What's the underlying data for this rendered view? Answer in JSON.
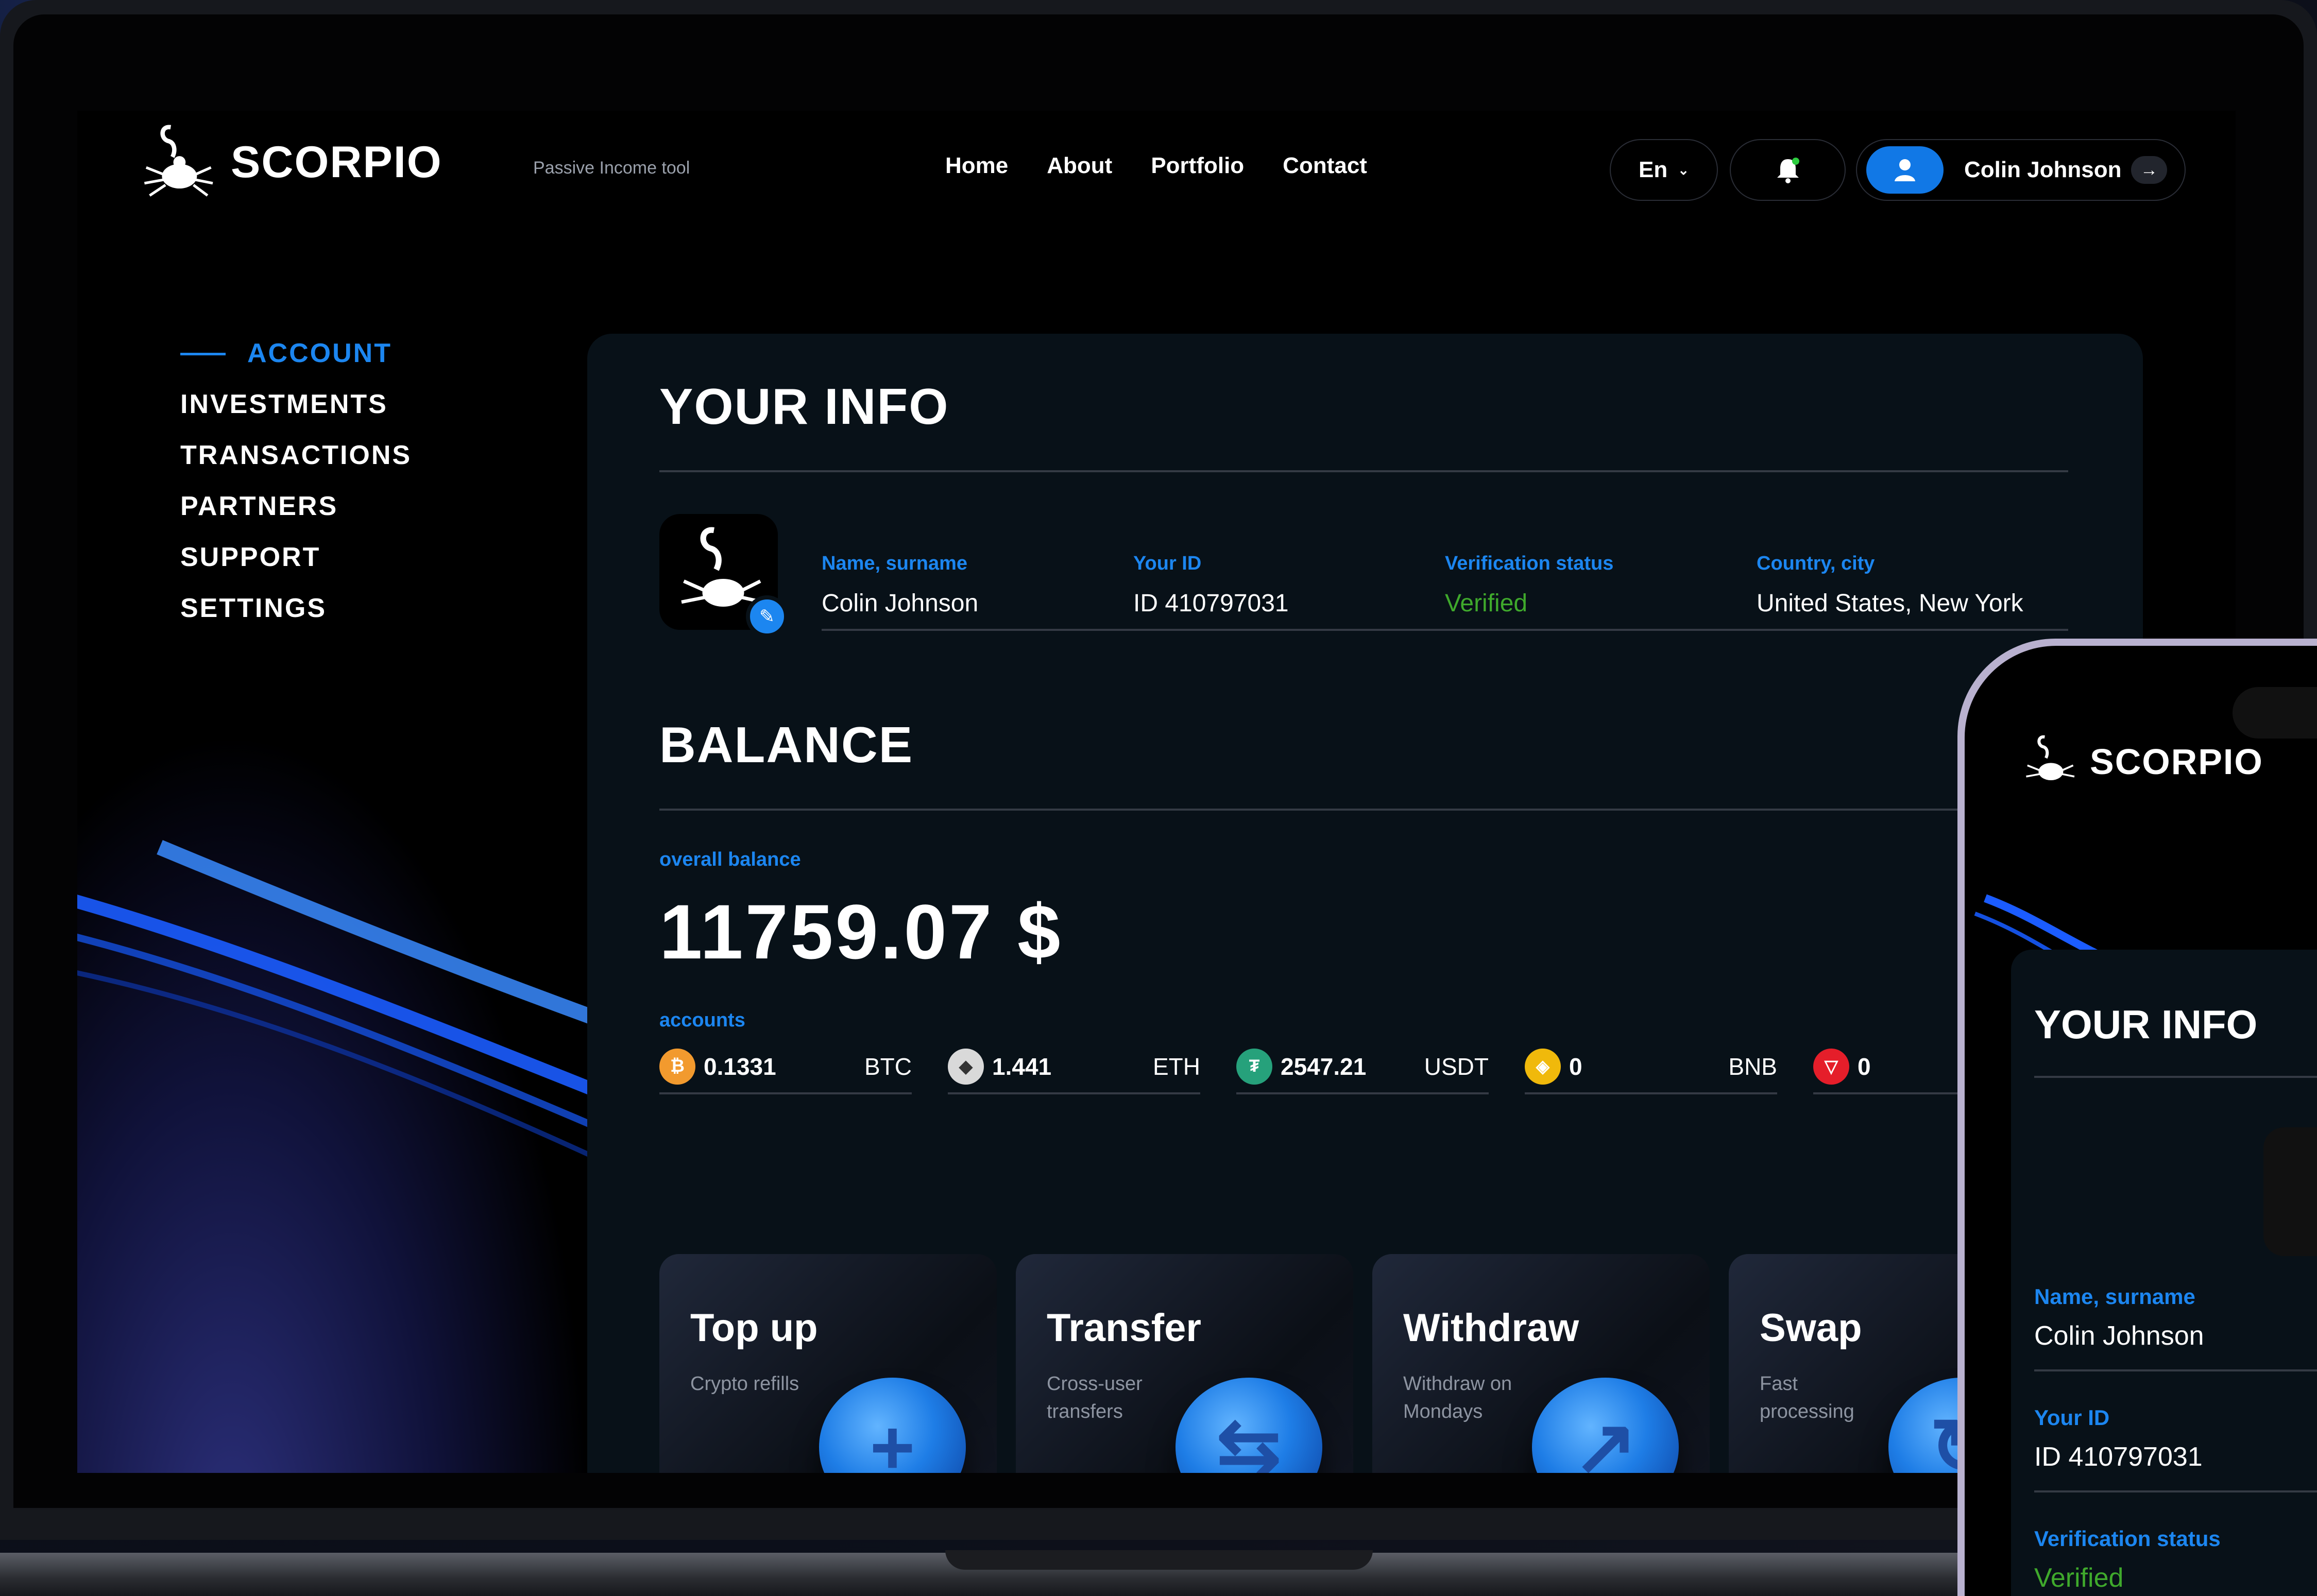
{
  "brand": {
    "name": "SCORPIO",
    "tagline": "Passive Income tool"
  },
  "nav": [
    "Home",
    "About",
    "Portfolio",
    "Contact"
  ],
  "header": {
    "language": "En",
    "user_name": "Colin Johnson",
    "logout_arrow": "→"
  },
  "sidebar": {
    "items": [
      "ACCOUNT",
      "INVESTMENTS",
      "TRANSACTIONS",
      "PARTNERS",
      "SUPPORT",
      "SETTINGS"
    ],
    "active": "ACCOUNT"
  },
  "info": {
    "title": "YOUR INFO",
    "fields": [
      {
        "label": "Name, surname",
        "value": "Colin Johnson"
      },
      {
        "label": "Your ID",
        "value": "ID 410797031"
      },
      {
        "label": "Verification status",
        "value": "Verified"
      },
      {
        "label": "Country, city",
        "value": "United States, New York"
      }
    ]
  },
  "balance": {
    "title": "BALANCE",
    "overall_label": "overall balance",
    "overall_value": "11759.07 $",
    "accounts_label": "accounts",
    "accounts": [
      {
        "amount": "0.1331",
        "symbol": "BTC",
        "icon": "bitcoin-icon",
        "color": "#f29a2e",
        "glyph": "₿"
      },
      {
        "amount": "1.441",
        "symbol": "ETH",
        "icon": "ethereum-icon",
        "color": "#d9d9d9",
        "glyph": "◆"
      },
      {
        "amount": "2547.21",
        "symbol": "USDT",
        "icon": "tether-icon",
        "color": "#26a17b",
        "glyph": "₮"
      },
      {
        "amount": "0",
        "symbol": "BNB",
        "icon": "bnb-icon",
        "color": "#f0b90b",
        "glyph": "◈"
      },
      {
        "amount": "0",
        "symbol": "",
        "icon": "tron-icon",
        "color": "#e51e2a",
        "glyph": "▽"
      }
    ]
  },
  "actions": [
    {
      "title": "Top up",
      "subtitle": "Crypto refills",
      "icon": "plus-icon",
      "glyph": "+"
    },
    {
      "title": "Transfer",
      "subtitle": "Cross-user transfers",
      "icon": "transfer-arrows-icon",
      "glyph": "⇆"
    },
    {
      "title": "Withdraw",
      "subtitle": "Withdraw on Mondays",
      "icon": "arrow-up-right-icon",
      "glyph": "↗"
    },
    {
      "title": "Swap",
      "subtitle": "Fast processing",
      "icon": "swap-icon",
      "glyph": "↻"
    }
  ],
  "phone": {
    "brand": "SCORPIO",
    "title": "YOUR INFO",
    "fields": [
      {
        "label": "Name, surname",
        "value": "Colin Johnson"
      },
      {
        "label": "Your ID",
        "value": "ID 410797031"
      },
      {
        "label": "Verification status",
        "value": "Verified"
      }
    ]
  },
  "colors": {
    "accent": "#1c86f0",
    "verified": "#3fa92c",
    "panel": "#081118"
  }
}
